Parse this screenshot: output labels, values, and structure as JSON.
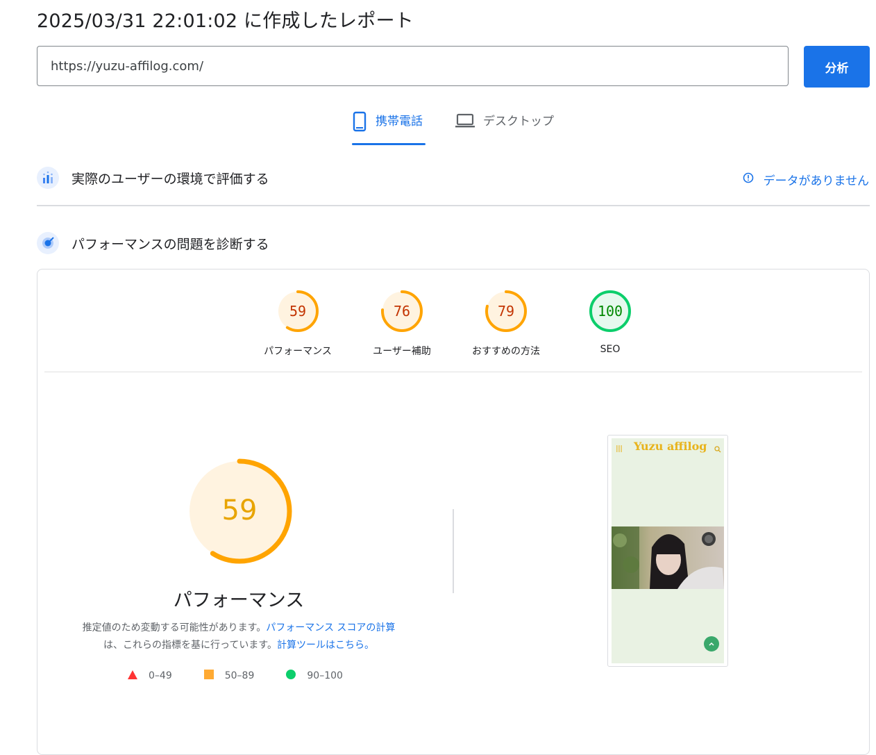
{
  "report_title": "2025/03/31 22:01:02 に作成したレポート",
  "url_input": {
    "value": "https://yuzu-affilog.com/"
  },
  "analyze_button": "分析",
  "tabs": [
    {
      "label": "携帯電話",
      "icon": "phone-icon",
      "active": true
    },
    {
      "label": "デスクトップ",
      "icon": "laptop-icon",
      "active": false
    }
  ],
  "field_data": {
    "heading": "実際のユーザーの環境で評価する",
    "status": "データがありません"
  },
  "lab_data": {
    "heading": "パフォーマンスの問題を診断する"
  },
  "scores": [
    {
      "label": "パフォーマンス",
      "value": 59,
      "color": "#ffa400",
      "text_color": "#c33300",
      "bg": "#fff3e0"
    },
    {
      "label": "ユーザー補助",
      "value": 76,
      "color": "#ffa400",
      "text_color": "#c33300",
      "bg": "#fff3e0"
    },
    {
      "label": "おすすめの方法",
      "value": 79,
      "color": "#ffa400",
      "text_color": "#c33300",
      "bg": "#fff3e0"
    },
    {
      "label": "SEO",
      "value": 100,
      "color": "#0cce6b",
      "text_color": "#008800",
      "bg": "#e6f9ee"
    }
  ],
  "main_score": {
    "value": 59,
    "label": "パフォーマンス"
  },
  "description": {
    "text1": "推定値のため変動する可能性があります。",
    "link1": "パフォーマンス スコアの計算",
    "text2": "は、これらの指標を基に行っています。",
    "link2": "計算ツールはこちら。"
  },
  "legend": [
    {
      "range": "0–49",
      "shape": "triangle",
      "color": "#ff3333"
    },
    {
      "range": "50–89",
      "shape": "square",
      "color": "#ffaa33"
    },
    {
      "range": "90–100",
      "shape": "circle",
      "color": "#0cce6b"
    }
  ],
  "screenshot": {
    "site_logo": "Yuzu affilog"
  }
}
